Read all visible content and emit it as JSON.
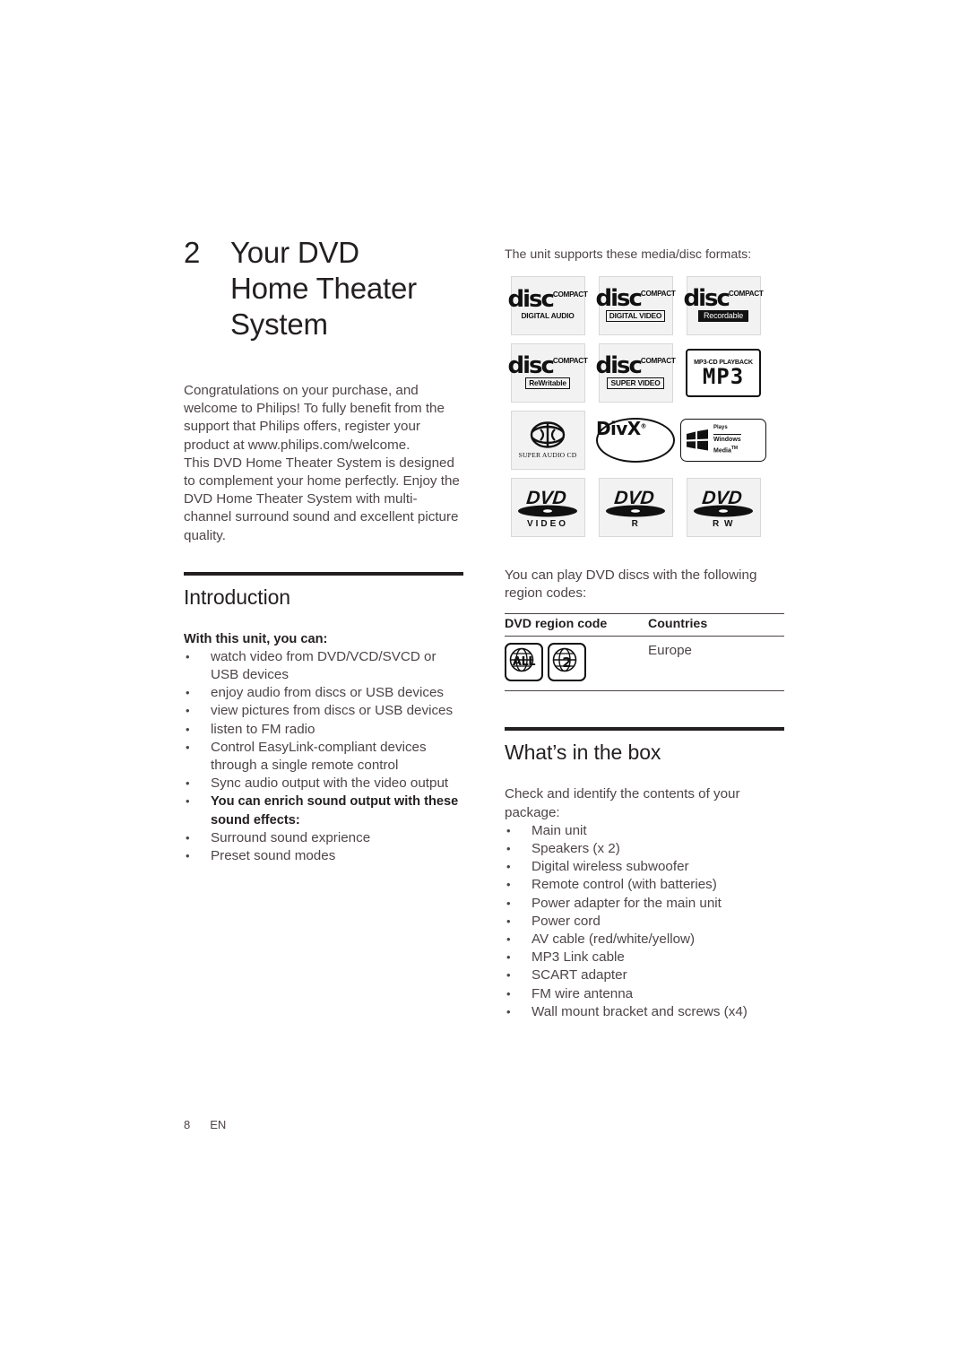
{
  "chapter": {
    "number": "2",
    "title_line1": "Your DVD",
    "title_line2": "Home Theater",
    "title_line3": "System"
  },
  "intro": {
    "paragraph1": "Congratulations on your purchase, and welcome to Philips! To fully benefit from the support that Philips offers, register your product at www.philips.com/welcome.",
    "paragraph2": "This DVD Home Theater System is designed to complement your home perfectly. Enjoy the DVD Home Theater System with multi-channel surround sound and excellent picture quality."
  },
  "introduction_section": {
    "heading": "Introduction",
    "lead": "With this unit, you can:",
    "capabilities": [
      "watch video from DVD/VCD/SVCD or USB devices",
      "enjoy audio from discs or USB devices",
      "view pictures from discs or USB devices",
      "listen to FM radio",
      "Control EasyLink-compliant devices through a single remote control",
      "Sync audio output with the video output"
    ],
    "effects_lead": "You can enrich sound output with these sound effects:",
    "effects": [
      "Surround sound exprience",
      "Preset sound modes"
    ]
  },
  "formats": {
    "note": "The unit supports these media/disc formats:",
    "logos": [
      {
        "type": "cd",
        "word": "disc",
        "compact": "COMPACT",
        "caption": "DIGITAL AUDIO",
        "caption_style": "plain",
        "name": "cd-digital-audio-logo"
      },
      {
        "type": "cd",
        "word": "disc",
        "compact": "COMPACT",
        "caption": "DIGITAL VIDEO",
        "caption_style": "boxed",
        "name": "cd-digital-video-logo"
      },
      {
        "type": "cd",
        "word": "disc",
        "compact": "COMPACT",
        "caption": "Recordable",
        "caption_style": "inverted",
        "name": "cd-recordable-logo"
      },
      {
        "type": "cd",
        "word": "disc",
        "compact": "COMPACT",
        "caption": "ReWritable",
        "caption_style": "boxed",
        "name": "cd-rewritable-logo"
      },
      {
        "type": "cd",
        "word": "disc",
        "compact": "COMPACT",
        "caption": "SUPER VIDEO",
        "caption_style": "boxed",
        "name": "cd-super-video-logo"
      },
      {
        "type": "mp3",
        "top": "MP3-CD PLAYBACK",
        "big": "MP3",
        "name": "mp3-cd-playback-logo"
      },
      {
        "type": "sacd",
        "caption": "SUPER AUDIO CD",
        "name": "super-audio-cd-logo"
      },
      {
        "type": "divx",
        "text": "DivX",
        "name": "divx-logo"
      },
      {
        "type": "wmedia",
        "plays": "Plays",
        "line1": "Windows",
        "line2": "Media",
        "tm": "TM",
        "name": "plays-windows-media-logo"
      },
      {
        "type": "dvd",
        "word": "DVD",
        "caption": "VIDEO",
        "name": "dvd-video-logo"
      },
      {
        "type": "dvd",
        "word": "DVD",
        "caption": "R",
        "name": "dvd-r-logo"
      },
      {
        "type": "dvd",
        "word": "DVD",
        "caption": "R W",
        "name": "dvd-rw-logo"
      }
    ]
  },
  "region": {
    "intro": "You can play DVD discs with the following region codes:",
    "header_code": "DVD region code",
    "header_countries": "Countries",
    "codes": [
      "ALL",
      "2"
    ],
    "countries": "Europe"
  },
  "box_section": {
    "heading": "What’s in the box",
    "lead": "Check and identify the contents of your package:",
    "items": [
      "Main unit",
      "Speakers (x 2)",
      "Digital wireless subwoofer",
      "Remote control (with batteries)",
      "Power adapter for the main unit",
      "Power cord",
      "AV cable (red/white/yellow)",
      "MP3 Link cable",
      "SCART adapter",
      "FM wire antenna",
      "Wall mount bracket and screws (x4)"
    ]
  },
  "footer": {
    "page_number": "8",
    "language": "EN"
  }
}
